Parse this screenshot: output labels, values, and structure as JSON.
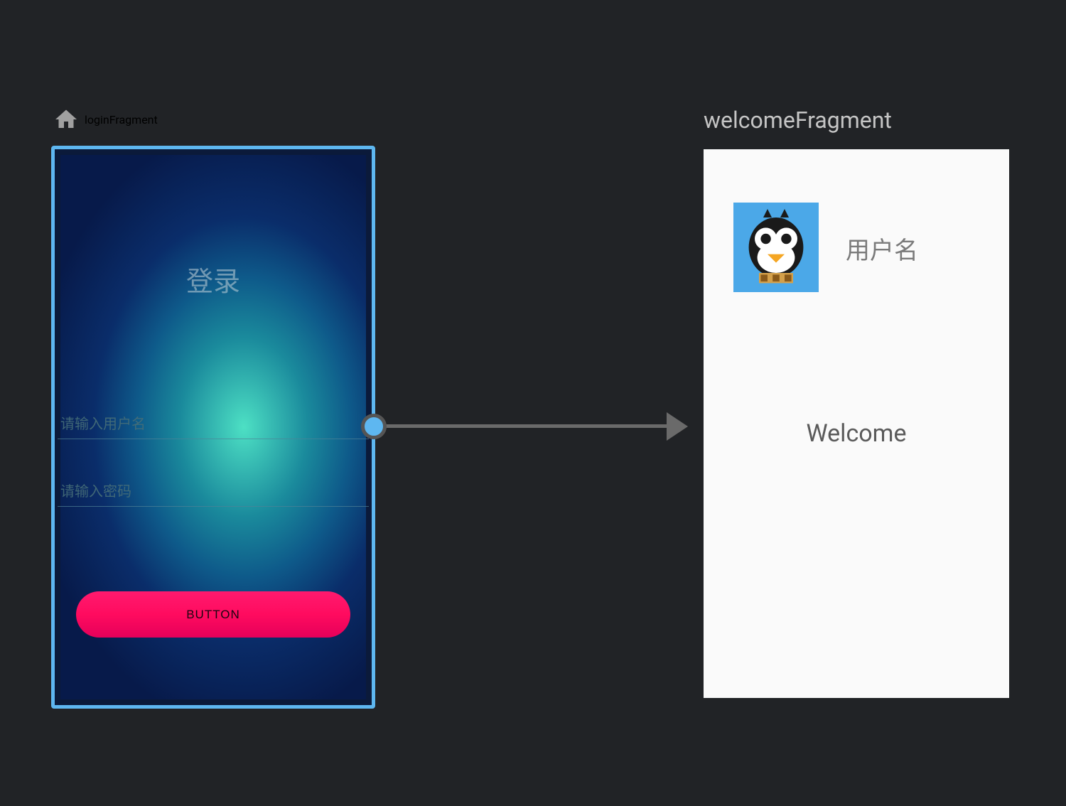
{
  "loginFragment": {
    "label": "loginFragment",
    "title": "登录",
    "usernamePlaceholder": "请输入用户名",
    "passwordPlaceholder": "请输入密码",
    "buttonLabel": "BUTTON"
  },
  "welcomeFragment": {
    "label": "welcomeFragment",
    "usernameText": "用户名",
    "welcomeText": "Welcome"
  }
}
